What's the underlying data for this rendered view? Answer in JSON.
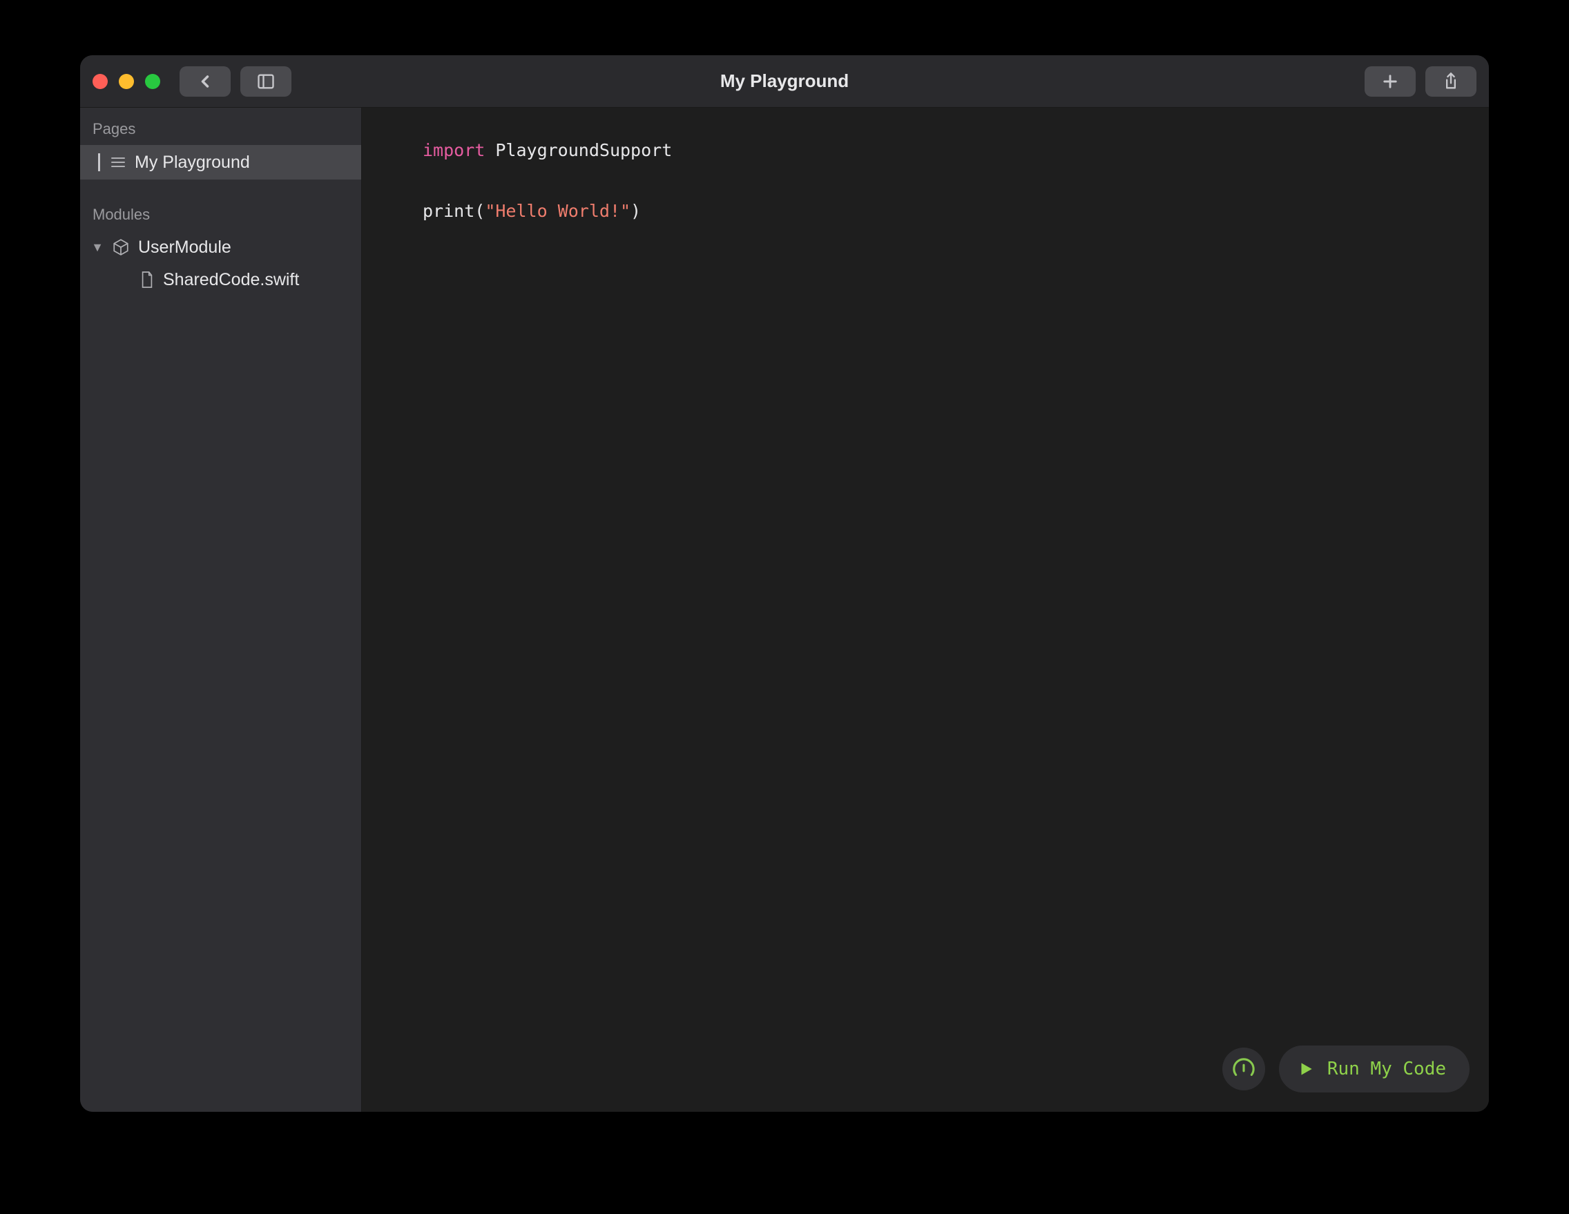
{
  "window": {
    "title": "My Playground"
  },
  "sidebar": {
    "pages_header": "Pages",
    "pages": [
      {
        "label": "My Playground",
        "selected": true
      }
    ],
    "modules_header": "Modules",
    "modules": [
      {
        "label": "UserModule",
        "expanded": true,
        "files": [
          {
            "label": "SharedCode.swift"
          }
        ]
      }
    ]
  },
  "editor": {
    "code": {
      "line1_kw": "import",
      "line1_id": "PlaygroundSupport",
      "line3_fn": "print",
      "line3_open": "(",
      "line3_str": "\"Hello World!\"",
      "line3_close": ")"
    }
  },
  "runbar": {
    "run_label": "Run My Code"
  }
}
